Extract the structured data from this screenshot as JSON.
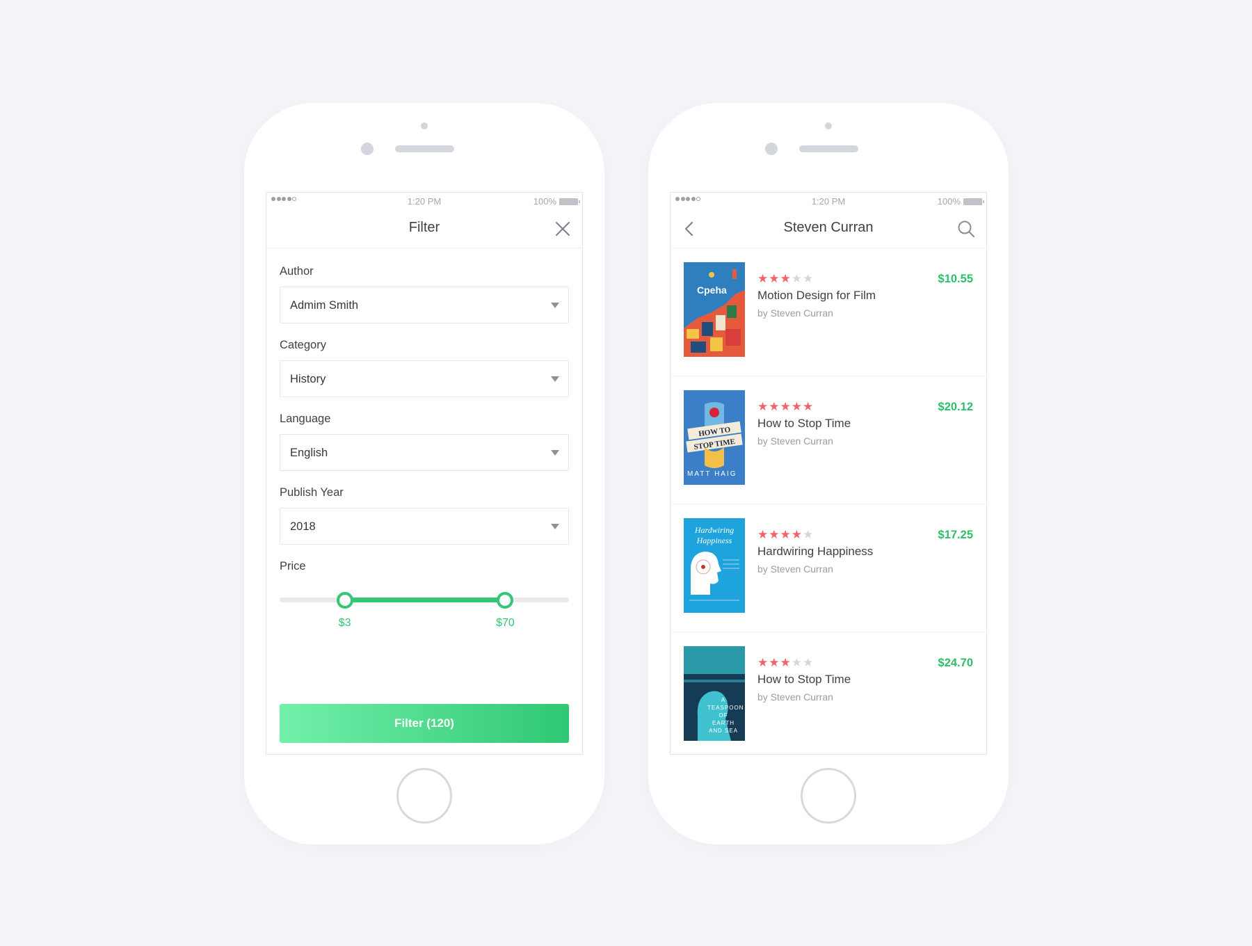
{
  "status_bar": {
    "time": "1:20 PM",
    "battery": "100%"
  },
  "filter_screen": {
    "title": "Filter",
    "fields": [
      {
        "label": "Author",
        "value": "Admim Smith"
      },
      {
        "label": "Category",
        "value": "History"
      },
      {
        "label": "Language",
        "value": "English"
      },
      {
        "label": "Publish Year",
        "value": "2018"
      }
    ],
    "price": {
      "label": "Price",
      "min_label": "$3",
      "max_label": "$70",
      "min_fraction": 0.225,
      "max_fraction": 0.78
    },
    "button_label": "Filter (120)"
  },
  "author_screen": {
    "title": "Steven Curran",
    "books": [
      {
        "title": "Motion Design for Film",
        "author": "by Steven Curran",
        "price": "$10.55",
        "rating": 3,
        "cover_text": "Cpeha",
        "cover_colors": [
          "#2f7fbf",
          "#e55a3c"
        ]
      },
      {
        "title": "How to Stop Time",
        "author": "by Steven Curran",
        "price": "$20.12",
        "rating": 5,
        "cover_text": "MATT HAIG",
        "cover_colors": [
          "#3a7fc8",
          "#f2c04a"
        ]
      },
      {
        "title": "Hardwiring Happiness",
        "author": "by Steven Curran",
        "price": "$17.25",
        "rating": 4,
        "cover_text": "Hardwiring Happiness",
        "cover_colors": [
          "#1ea3dc",
          "#ffffff"
        ]
      },
      {
        "title": "How to Stop Time",
        "author": "by Steven Curran",
        "price": "$24.70",
        "rating": 3,
        "cover_text": "A TEASPOON OF EARTH AND SEA",
        "cover_colors": [
          "#2a9aa8",
          "#153b55"
        ]
      }
    ]
  },
  "colors": {
    "accent": "#33c775",
    "star": "#f0636b",
    "price": "#2ebd6b"
  },
  "icons": {
    "close": "close-icon",
    "back": "chevron-left-icon",
    "search": "search-icon",
    "dropdown": "chevron-down-icon"
  }
}
